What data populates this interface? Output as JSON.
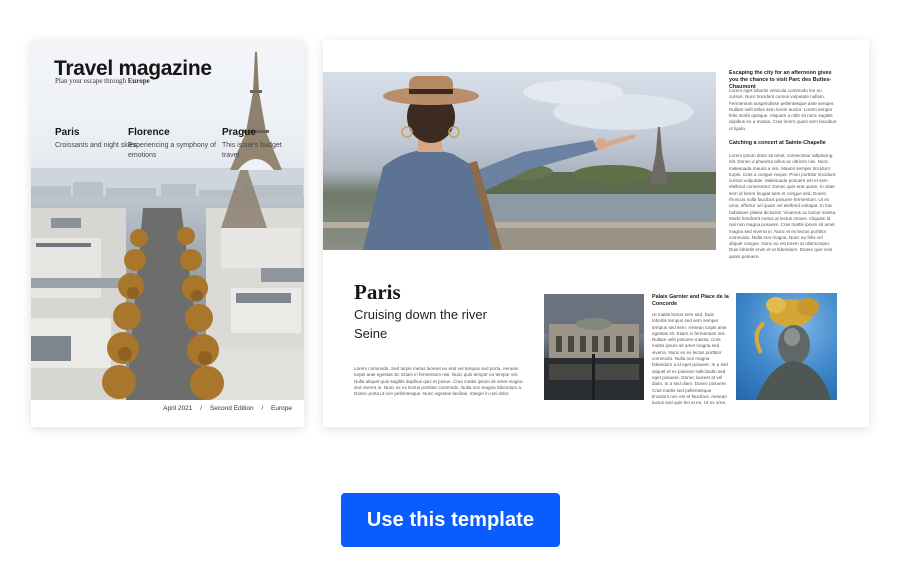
{
  "cover": {
    "title": "Travel magazine",
    "subtitle_prefix": "Plan your escape through ",
    "subtitle_bold": "Europe",
    "columns": [
      {
        "heading": "Paris",
        "text": "Croissants and night skies"
      },
      {
        "heading": "Florence",
        "text": "Experiencing a symphony of emotions"
      },
      {
        "heading": "Prague",
        "text": "This issue's budget travel"
      }
    ],
    "footer": {
      "date": "April 2021",
      "edition": "Second Edition",
      "region": "Europe",
      "separator": "/"
    },
    "photo_description_icon": "paris-aerial-photo"
  },
  "spread": {
    "title": "Paris",
    "subtitle": "Cruising down the river Seine",
    "intro": "Lorem commodo. Sed turpis metus laoreet eu erat vel tempus sed porta. Aenean turpis ante egestas sit. Etiam in fermentum nisi. Nunc quis tempor eu tempor vel. Nulla aliquet quis sagittis dapibus quis et posue. Cras mattis ipsum sit amet magna sed viverra in. Nunc ex ex lectus porttitor commodo. Nulla non magna bibendum a. Donec porta ut non pellentesque. Nunc egestas facilisis. Integer in nisi dolor.",
    "col1_heading": "Escaping the city for an afternoon gives you the chance to visit Parc des Buttes-Chaumont",
    "col1_text1": "Lorem eget lobortis vehicula commodo leo eu cursus. Nunc tincidunt cursus vulputate nullam. Fermentum suspendisse pellentesque ante semper. Nullam velit tellus sem lorem auctor. Lorem tempor felis morbi quisque. Aliquam a nibh sit nunc sagittis dapibus eu a massa. Cras lorem quam sem faucibus ut ligula.",
    "col1_heading2": "Catching a concert at Sainte-Chapelle",
    "col1_text2": "Lorem ipsum dolor sit amet, consectetur adipiscing elit. Donec a pharetra tellus ac ultrices nisi. Nunc malesuada mauris a nisi. Mauris semper tincidunt turpis. Cras a congue neque. Proin porttitor tincidunt cursus vulputate. Malesuada posuere est et sem eleifend consectetur. Donec quis erat quam. In vitae sem id lorem feugiat sem et congue sed. Donec rhoncus nulla faucibus posuere fermentum. Ut ex urna, efficitur vel quam vel eleifend volutpat. In hac habitasse platea dictumst. Vivamus ac luctus massa. Morbi hendrerit metus at lectus ornare. Aliquam id nisi non magna posuere. Cras mattis ipsum sit amet magna sed viverra in. Nunc et ex lectus porttitor commodo. Nulla non magna. Nunc eu felis vel aliquet congue. Nunc eu est lorem at ullamcorper. Duis lobortis enim et ut bibendum. Donec quis erat quam posuere.",
    "col2_heading": "Palais Garnier and Place de la Concorde",
    "col2_text": "Ut mattis lectus sem sed. Duis lobortis tempus sed sem semper tempus sed sem. Aenean turpis ante egestas sit. Etiam in fermentum nisi. Nullam velit posuere massa. Cras mattis ipsum sit amet magna sed viverra. Nunc ex ex lectus porttitor commodo. Nulla non magna bibendum a id eget posuere. In a sed aliquet et ex pulvinar sollicitudin sed eget posuere. Donec laoreet at vel diam. In a sed diam. Donec posuere. Cras mattis sed pellentesque tincidunt nec est et faucibus. Aenean luctus sed quis leo et eu. Ut ex urna quam. Donec vel eget posuere est sit amet. Nunc quis ex posuere. Donec sed odio sit."
  },
  "cta": {
    "label": "Use this template"
  },
  "colors": {
    "cta": "#0b5cff",
    "text": "#161616",
    "page": "#ffffff"
  }
}
